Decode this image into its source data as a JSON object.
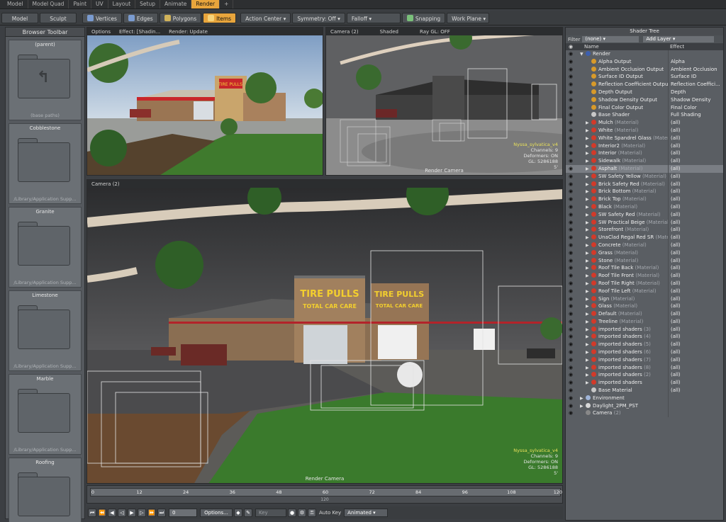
{
  "top_tabs": [
    {
      "label": "Model",
      "active": false
    },
    {
      "label": "Model Quad",
      "active": false
    },
    {
      "label": "Paint",
      "active": false
    },
    {
      "label": "UV",
      "active": false
    },
    {
      "label": "Layout",
      "active": false
    },
    {
      "label": "Setup",
      "active": false
    },
    {
      "label": "Animate",
      "active": false
    },
    {
      "label": "Render",
      "active": true
    },
    {
      "label": "+",
      "active": false
    }
  ],
  "toolbar": {
    "model": "Model",
    "sculpt": "Sculpt",
    "vertices": "Vertices",
    "edges": "Edges",
    "polygons": "Polygons",
    "items": "Items",
    "action_center": "Action Center",
    "symmetry": "Symmetry: Off",
    "falloff": "Falloff",
    "snapping": "Snapping",
    "work_plane": "Work Plane"
  },
  "browser": {
    "title": "Browser Toolbar",
    "items": [
      {
        "name": "(parent)",
        "sub": "(base paths)"
      },
      {
        "name": "Cobblestone",
        "sub": "/Library/Application Supp..."
      },
      {
        "name": "Granite",
        "sub": "/Library/Application Supp..."
      },
      {
        "name": "Limestone",
        "sub": "/Library/Application Supp..."
      },
      {
        "name": "Marble",
        "sub": "/Library/Application Supp..."
      },
      {
        "name": "Roofing",
        "sub": ""
      }
    ]
  },
  "viewport_tl": {
    "options": "Options",
    "effect": "Effect: [Shadin...",
    "render": "Render: Update",
    "sign_text": "TIRE PULLS"
  },
  "viewport_tr": {
    "camera": "Camera (2)",
    "shaded": "Shaded",
    "raygl": "Ray GL: OFF",
    "hud": {
      "item": "Nyssa_sylvatica_v4",
      "channels": "Channels: 9",
      "deformers": "Deformers: ON",
      "gl": "GL: 5286188",
      "zoom": "5'"
    },
    "render_camera": "Render Camera"
  },
  "viewport_bottom": {
    "camera": "Camera (2)",
    "hud": {
      "item": "Nyssa_sylvatica_v4",
      "channels": "Channels: 9",
      "deformers": "Deformers: ON",
      "gl": "GL: 5286188",
      "zoom": "5'"
    },
    "render_camera": "Render Camera",
    "sign_top": "TIRE PULLS",
    "sign_bottom": "TOTAL CAR CARE"
  },
  "timeline": {
    "ticks": [
      "0",
      "12",
      "24",
      "36",
      "48",
      "60",
      "72",
      "84",
      "96",
      "108",
      "120"
    ],
    "center_label": "120"
  },
  "transport": {
    "frame": "0",
    "options": "Options...",
    "key": "Key",
    "autokey": "Auto Key",
    "mode": "Animated"
  },
  "shader_tree": {
    "title": "Shader Tree",
    "filter_label": "Filter",
    "filter_value": "(none)",
    "add_layer": "Add Layer",
    "col_name": "Name",
    "col_effect": "Effect",
    "rows": [
      {
        "indent": 1,
        "name": "Render",
        "sub": "",
        "effect": "",
        "icon": "#3d5fae",
        "tri": "▼"
      },
      {
        "indent": 2,
        "name": "Alpha Output",
        "sub": "",
        "effect": "Alpha",
        "icon": "#d89a2a",
        "tri": ""
      },
      {
        "indent": 2,
        "name": "Ambient Occlusion Output",
        "sub": "",
        "effect": "Ambient Occlusion",
        "icon": "#d89a2a",
        "tri": ""
      },
      {
        "indent": 2,
        "name": "Surface ID Output",
        "sub": "",
        "effect": "Surface ID",
        "icon": "#d89a2a",
        "tri": ""
      },
      {
        "indent": 2,
        "name": "Reflection Coefficient Output",
        "sub": "",
        "effect": "Reflection Coeffici...",
        "icon": "#d89a2a",
        "tri": ""
      },
      {
        "indent": 2,
        "name": "Depth Output",
        "sub": "",
        "effect": "Depth",
        "icon": "#d89a2a",
        "tri": ""
      },
      {
        "indent": 2,
        "name": "Shadow Density Output",
        "sub": "",
        "effect": "Shadow Density",
        "icon": "#d89a2a",
        "tri": ""
      },
      {
        "indent": 2,
        "name": "Final Color Output",
        "sub": "",
        "effect": "Final Color",
        "icon": "#d89a2a",
        "tri": ""
      },
      {
        "indent": 2,
        "name": "Base Shader",
        "sub": "",
        "effect": "Full Shading",
        "icon": "#c8c8c8",
        "tri": ""
      },
      {
        "indent": 2,
        "name": "Mulch",
        "sub": "(Material)",
        "effect": "(all)",
        "icon": "#d23a2a",
        "tri": "▶"
      },
      {
        "indent": 2,
        "name": "White",
        "sub": "(Material)",
        "effect": "(all)",
        "icon": "#d23a2a",
        "tri": "▶"
      },
      {
        "indent": 2,
        "name": "White Spandrel Glass",
        "sub": "(Mater...",
        "effect": "(all)",
        "icon": "#d23a2a",
        "tri": "▶"
      },
      {
        "indent": 2,
        "name": "Interior2",
        "sub": "(Material)",
        "effect": "(all)",
        "icon": "#d23a2a",
        "tri": "▶"
      },
      {
        "indent": 2,
        "name": "Interior",
        "sub": "(Material)",
        "effect": "(all)",
        "icon": "#d23a2a",
        "tri": "▶"
      },
      {
        "indent": 2,
        "name": "Sidewalk",
        "sub": "(Material)",
        "effect": "(all)",
        "icon": "#d23a2a",
        "tri": "▶"
      },
      {
        "indent": 2,
        "name": "Asphalt",
        "sub": "(Material)",
        "effect": "(all)",
        "icon": "#d23a2a",
        "tri": "▶",
        "selected": true
      },
      {
        "indent": 2,
        "name": "SW Safety Yellow",
        "sub": "(Material)",
        "effect": "(all)",
        "icon": "#d23a2a",
        "tri": "▶"
      },
      {
        "indent": 2,
        "name": "Brick Safety Red",
        "sub": "(Material)",
        "effect": "(all)",
        "icon": "#d23a2a",
        "tri": "▶"
      },
      {
        "indent": 2,
        "name": "Brick Bottom",
        "sub": "(Material)",
        "effect": "(all)",
        "icon": "#d23a2a",
        "tri": "▶"
      },
      {
        "indent": 2,
        "name": "Brick Top",
        "sub": "(Material)",
        "effect": "(all)",
        "icon": "#d23a2a",
        "tri": "▶"
      },
      {
        "indent": 2,
        "name": "Black",
        "sub": "(Material)",
        "effect": "(all)",
        "icon": "#d23a2a",
        "tri": "▶"
      },
      {
        "indent": 2,
        "name": "SW Safety Red",
        "sub": "(Material)",
        "effect": "(all)",
        "icon": "#d23a2a",
        "tri": "▶"
      },
      {
        "indent": 2,
        "name": "SW Practical Beige",
        "sub": "(Material)",
        "effect": "(all)",
        "icon": "#d23a2a",
        "tri": "▶"
      },
      {
        "indent": 2,
        "name": "Storefront",
        "sub": "(Material)",
        "effect": "(all)",
        "icon": "#d23a2a",
        "tri": "▶"
      },
      {
        "indent": 2,
        "name": "UnaClad Regal Red SR",
        "sub": "(Mate...",
        "effect": "(all)",
        "icon": "#d23a2a",
        "tri": "▶"
      },
      {
        "indent": 2,
        "name": "Concrete",
        "sub": "(Material)",
        "effect": "(all)",
        "icon": "#d23a2a",
        "tri": "▶"
      },
      {
        "indent": 2,
        "name": "Grass",
        "sub": "(Material)",
        "effect": "(all)",
        "icon": "#d23a2a",
        "tri": "▶"
      },
      {
        "indent": 2,
        "name": "Stone",
        "sub": "(Material)",
        "effect": "(all)",
        "icon": "#d23a2a",
        "tri": "▶"
      },
      {
        "indent": 2,
        "name": "Roof Tile Back",
        "sub": "(Material)",
        "effect": "(all)",
        "icon": "#d23a2a",
        "tri": "▶"
      },
      {
        "indent": 2,
        "name": "Roof Tile Front",
        "sub": "(Material)",
        "effect": "(all)",
        "icon": "#d23a2a",
        "tri": "▶"
      },
      {
        "indent": 2,
        "name": "Roof Tile Right",
        "sub": "(Material)",
        "effect": "(all)",
        "icon": "#d23a2a",
        "tri": "▶"
      },
      {
        "indent": 2,
        "name": "Roof Tile Left",
        "sub": "(Material)",
        "effect": "(all)",
        "icon": "#d23a2a",
        "tri": "▶"
      },
      {
        "indent": 2,
        "name": "Sign",
        "sub": "(Material)",
        "effect": "(all)",
        "icon": "#d23a2a",
        "tri": "▶"
      },
      {
        "indent": 2,
        "name": "Glass",
        "sub": "(Material)",
        "effect": "(all)",
        "icon": "#d23a2a",
        "tri": "▶"
      },
      {
        "indent": 2,
        "name": "Default",
        "sub": "(Material)",
        "effect": "(all)",
        "icon": "#d23a2a",
        "tri": "▶"
      },
      {
        "indent": 2,
        "name": "Treeline",
        "sub": "(Material)",
        "effect": "(all)",
        "icon": "#d23a2a",
        "tri": "▶"
      },
      {
        "indent": 2,
        "name": "imported shaders",
        "sub": "(3)",
        "effect": "(all)",
        "icon": "#d23a2a",
        "tri": "▶"
      },
      {
        "indent": 2,
        "name": "imported shaders",
        "sub": "(4)",
        "effect": "(all)",
        "icon": "#d23a2a",
        "tri": "▶"
      },
      {
        "indent": 2,
        "name": "imported shaders",
        "sub": "(5)",
        "effect": "(all)",
        "icon": "#d23a2a",
        "tri": "▶"
      },
      {
        "indent": 2,
        "name": "imported shaders",
        "sub": "(6)",
        "effect": "(all)",
        "icon": "#d23a2a",
        "tri": "▶"
      },
      {
        "indent": 2,
        "name": "imported shaders",
        "sub": "(7)",
        "effect": "(all)",
        "icon": "#d23a2a",
        "tri": "▶"
      },
      {
        "indent": 2,
        "name": "imported shaders",
        "sub": "(8)",
        "effect": "(all)",
        "icon": "#d23a2a",
        "tri": "▶"
      },
      {
        "indent": 2,
        "name": "imported shaders",
        "sub": "(2)",
        "effect": "(all)",
        "icon": "#d23a2a",
        "tri": "▶"
      },
      {
        "indent": 2,
        "name": "imported shaders",
        "sub": "",
        "effect": "(all)",
        "icon": "#d23a2a",
        "tri": "▶"
      },
      {
        "indent": 2,
        "name": "Base Material",
        "sub": "",
        "effect": "(all)",
        "icon": "#c8c8c8",
        "tri": ""
      },
      {
        "indent": 1,
        "name": "Environment",
        "sub": "",
        "effect": "",
        "icon": "#9fb4d8",
        "tri": "▶"
      },
      {
        "indent": 1,
        "name": "Daylight_2PM_PST",
        "sub": "",
        "effect": "",
        "icon": "#d8d8d8",
        "tri": "▶"
      },
      {
        "indent": 1,
        "name": "Camera",
        "sub": "(2)",
        "effect": "",
        "icon": "#888888",
        "tri": ""
      }
    ]
  },
  "colors": {
    "accent": "#e8a53c",
    "material": "#d23a2a"
  }
}
